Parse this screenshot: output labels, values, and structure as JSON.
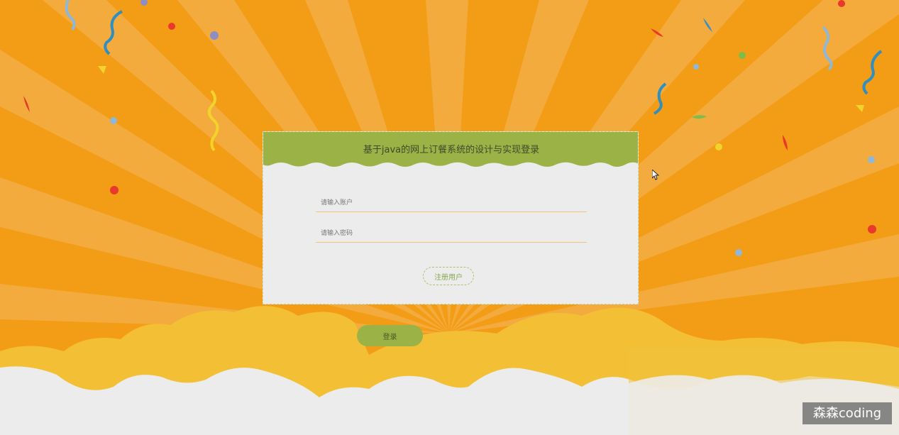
{
  "login": {
    "title": "基于java的网上订餐系统的设计与实现登录",
    "username_placeholder": "请输入账户",
    "password_placeholder": "请输入密码",
    "register_label": "注册用户",
    "login_label": "登录"
  },
  "watermark": {
    "text": "森森coding"
  },
  "colors": {
    "background": "#f39c16",
    "header_green": "#9bb247",
    "card_bg": "#ececec",
    "cloud_yellow": "#f2bf35",
    "cloud_white": "#ececec"
  }
}
